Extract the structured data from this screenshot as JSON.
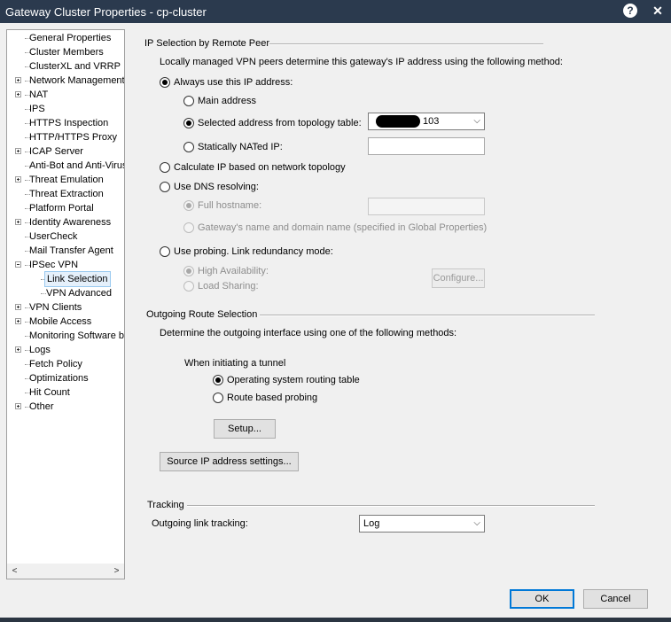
{
  "window": {
    "title": "Gateway Cluster Properties - cp-cluster",
    "help": "?",
    "close": "✕"
  },
  "tree": {
    "items": [
      {
        "label": "General Properties",
        "expandable": false,
        "child": false,
        "selected": false
      },
      {
        "label": "Cluster Members",
        "expandable": false,
        "child": false,
        "selected": false
      },
      {
        "label": "ClusterXL and VRRP",
        "expandable": false,
        "child": false,
        "selected": false
      },
      {
        "label": "Network Management",
        "expandable": true,
        "expanded": false,
        "child": false,
        "selected": false
      },
      {
        "label": "NAT",
        "expandable": true,
        "expanded": false,
        "child": false,
        "selected": false
      },
      {
        "label": "IPS",
        "expandable": false,
        "child": false,
        "selected": false
      },
      {
        "label": "HTTPS Inspection",
        "expandable": false,
        "child": false,
        "selected": false
      },
      {
        "label": "HTTP/HTTPS Proxy",
        "expandable": false,
        "child": false,
        "selected": false
      },
      {
        "label": "ICAP Server",
        "expandable": true,
        "expanded": false,
        "child": false,
        "selected": false
      },
      {
        "label": "Anti-Bot and Anti-Virus",
        "expandable": false,
        "child": false,
        "selected": false
      },
      {
        "label": "Threat Emulation",
        "expandable": true,
        "expanded": false,
        "child": false,
        "selected": false
      },
      {
        "label": "Threat Extraction",
        "expandable": false,
        "child": false,
        "selected": false
      },
      {
        "label": "Platform Portal",
        "expandable": false,
        "child": false,
        "selected": false
      },
      {
        "label": "Identity Awareness",
        "expandable": true,
        "expanded": false,
        "child": false,
        "selected": false
      },
      {
        "label": "UserCheck",
        "expandable": false,
        "child": false,
        "selected": false
      },
      {
        "label": "Mail Transfer Agent",
        "expandable": false,
        "child": false,
        "selected": false
      },
      {
        "label": "IPSec VPN",
        "expandable": true,
        "expanded": true,
        "child": false,
        "selected": false
      },
      {
        "label": "Link Selection",
        "expandable": false,
        "child": true,
        "selected": true
      },
      {
        "label": "VPN Advanced",
        "expandable": false,
        "child": true,
        "selected": false
      },
      {
        "label": "VPN Clients",
        "expandable": true,
        "expanded": false,
        "child": false,
        "selected": false
      },
      {
        "label": "Mobile Access",
        "expandable": true,
        "expanded": false,
        "child": false,
        "selected": false
      },
      {
        "label": "Monitoring Software bla",
        "expandable": false,
        "child": false,
        "selected": false
      },
      {
        "label": "Logs",
        "expandable": true,
        "expanded": false,
        "child": false,
        "selected": false
      },
      {
        "label": "Fetch Policy",
        "expandable": false,
        "child": false,
        "selected": false
      },
      {
        "label": "Optimizations",
        "expandable": false,
        "child": false,
        "selected": false
      },
      {
        "label": "Hit Count",
        "expandable": false,
        "child": false,
        "selected": false
      },
      {
        "label": "Other",
        "expandable": true,
        "expanded": false,
        "child": false,
        "selected": false
      }
    ],
    "scroll_left": "<",
    "scroll_right": ">"
  },
  "ip_selection": {
    "header": "IP Selection by Remote Peer",
    "description": "Locally managed VPN peers determine this gateway's IP address using the following method:",
    "always_use": "Always use this IP address:",
    "main_address": "Main address",
    "selected_from_topology": "Selected address from topology table:",
    "topology_value": "103",
    "statically_nated": "Statically NATed IP:",
    "calculate": "Calculate IP based on network topology",
    "dns": "Use DNS resolving:",
    "full_hostname": "Full hostname:",
    "gateway_name": "Gateway's name and domain name (specified in Global Properties)",
    "probing": "Use probing. Link redundancy mode:",
    "high_availability": "High Availability:",
    "load_sharing": "Load Sharing:",
    "configure": "Configure..."
  },
  "outgoing": {
    "header": "Outgoing Route Selection",
    "description": "Determine the outgoing interface using one of the following methods:",
    "when_initiating": "When initiating a tunnel",
    "os_routing": "Operating system routing table",
    "route_probing": "Route based probing",
    "setup": "Setup...",
    "source_ip": "Source IP address settings..."
  },
  "tracking": {
    "header": "Tracking",
    "label": "Outgoing link tracking:",
    "value": "Log"
  },
  "buttons": {
    "ok": "OK",
    "cancel": "Cancel"
  },
  "icons": {
    "chevron": "chevron-down-icon",
    "help": "help-icon",
    "close": "close-icon"
  }
}
